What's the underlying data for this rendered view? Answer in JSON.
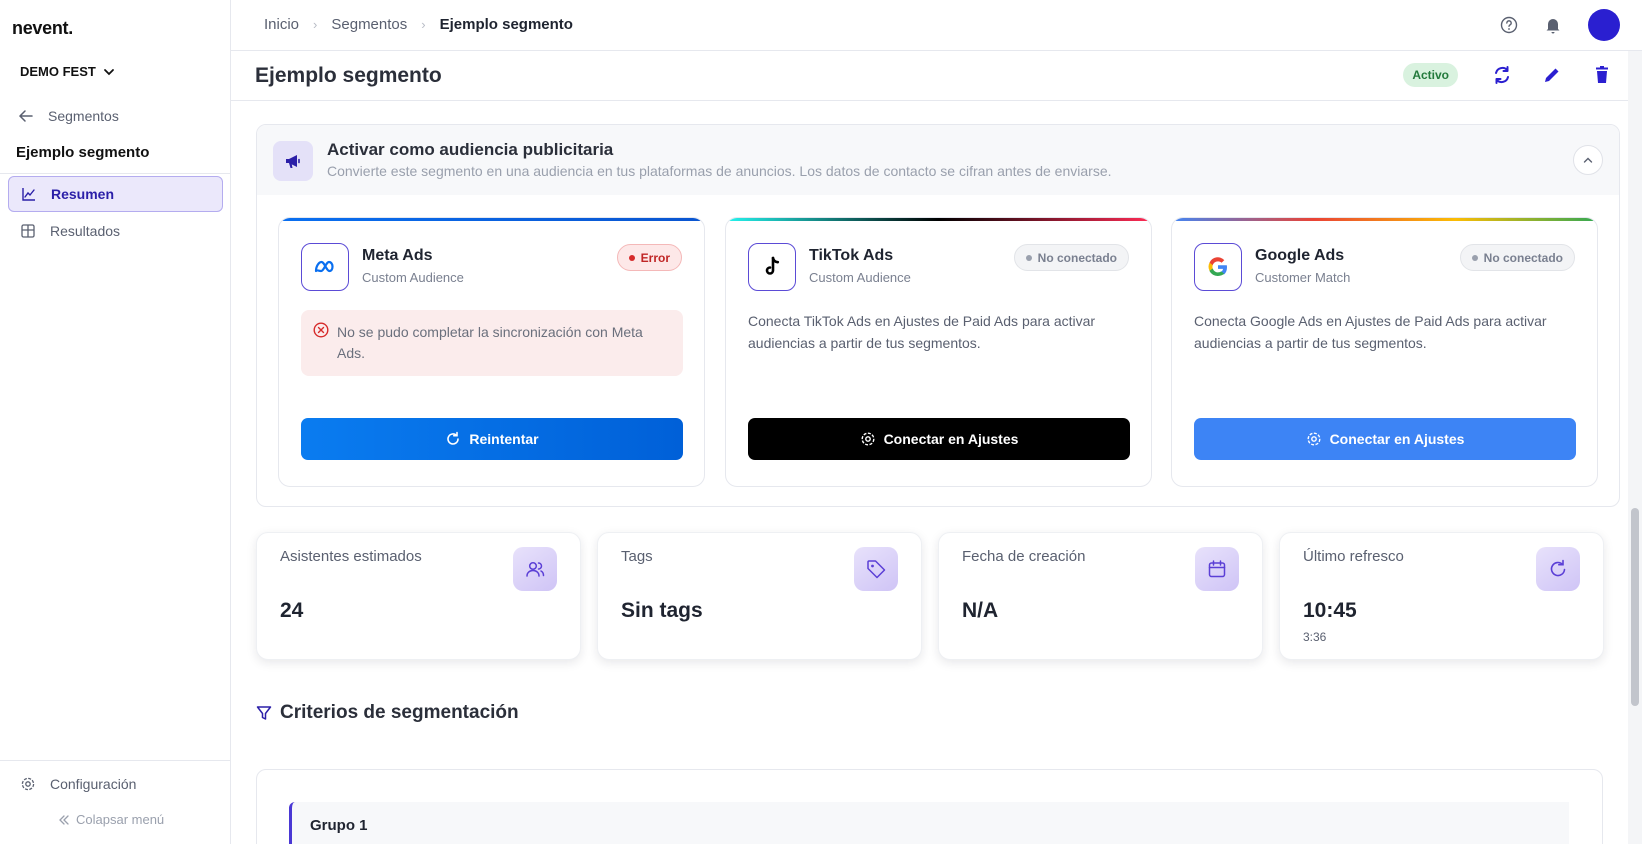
{
  "sidebar": {
    "logo": "nevent.",
    "org": "DEMO FEST",
    "back_label": "Segmentos",
    "segment_title": "Ejemplo segmento",
    "items": [
      {
        "label": "Resumen",
        "active": true
      },
      {
        "label": "Resultados",
        "active": false
      }
    ],
    "config_label": "Configuración",
    "collapse_label": "Colapsar menú"
  },
  "breadcrumb": [
    "Inicio",
    "Segmentos",
    "Ejemplo segmento"
  ],
  "header": {
    "title": "Ejemplo segmento",
    "status": "Activo"
  },
  "ads_panel": {
    "title": "Activar como audiencia publicitaria",
    "subtitle": "Convierte este segmento en una audiencia en tus plataformas de anuncios. Los datos de contacto se cifran antes de enviarse.",
    "cards": [
      {
        "name": "Meta Ads",
        "type": "Custom Audience",
        "status": "Error",
        "error": "No se pudo completar la sincronización con Meta Ads.",
        "button": "Reintentar"
      },
      {
        "name": "TikTok Ads",
        "type": "Custom Audience",
        "status": "No conectado",
        "description": "Conecta TikTok Ads en Ajustes de Paid Ads para activar audiencias a partir de tus segmentos.",
        "button": "Conectar en Ajustes"
      },
      {
        "name": "Google Ads",
        "type": "Customer Match",
        "status": "No conectado",
        "description": "Conecta Google Ads en Ajustes de Paid Ads para activar audiencias a partir de tus segmentos.",
        "button": "Conectar en Ajustes"
      }
    ]
  },
  "stats": [
    {
      "label": "Asistentes estimados",
      "value": "24",
      "icon": "users-icon"
    },
    {
      "label": "Tags",
      "value": "Sin tags",
      "icon": "tag-icon"
    },
    {
      "label": "Fecha de creación",
      "value": "N/A",
      "icon": "calendar-icon"
    },
    {
      "label": "Último refresco",
      "value": "10:45",
      "sub": "3:36",
      "icon": "refresh-icon"
    }
  ],
  "criteria": {
    "title": "Criterios de segmentación",
    "group": "Grupo 1"
  },
  "colors": {
    "accent": "#2b1fa8",
    "meta": "#0a7cf0",
    "google": "#3d84f5",
    "error": "#c02626",
    "active": "#237a3c"
  }
}
